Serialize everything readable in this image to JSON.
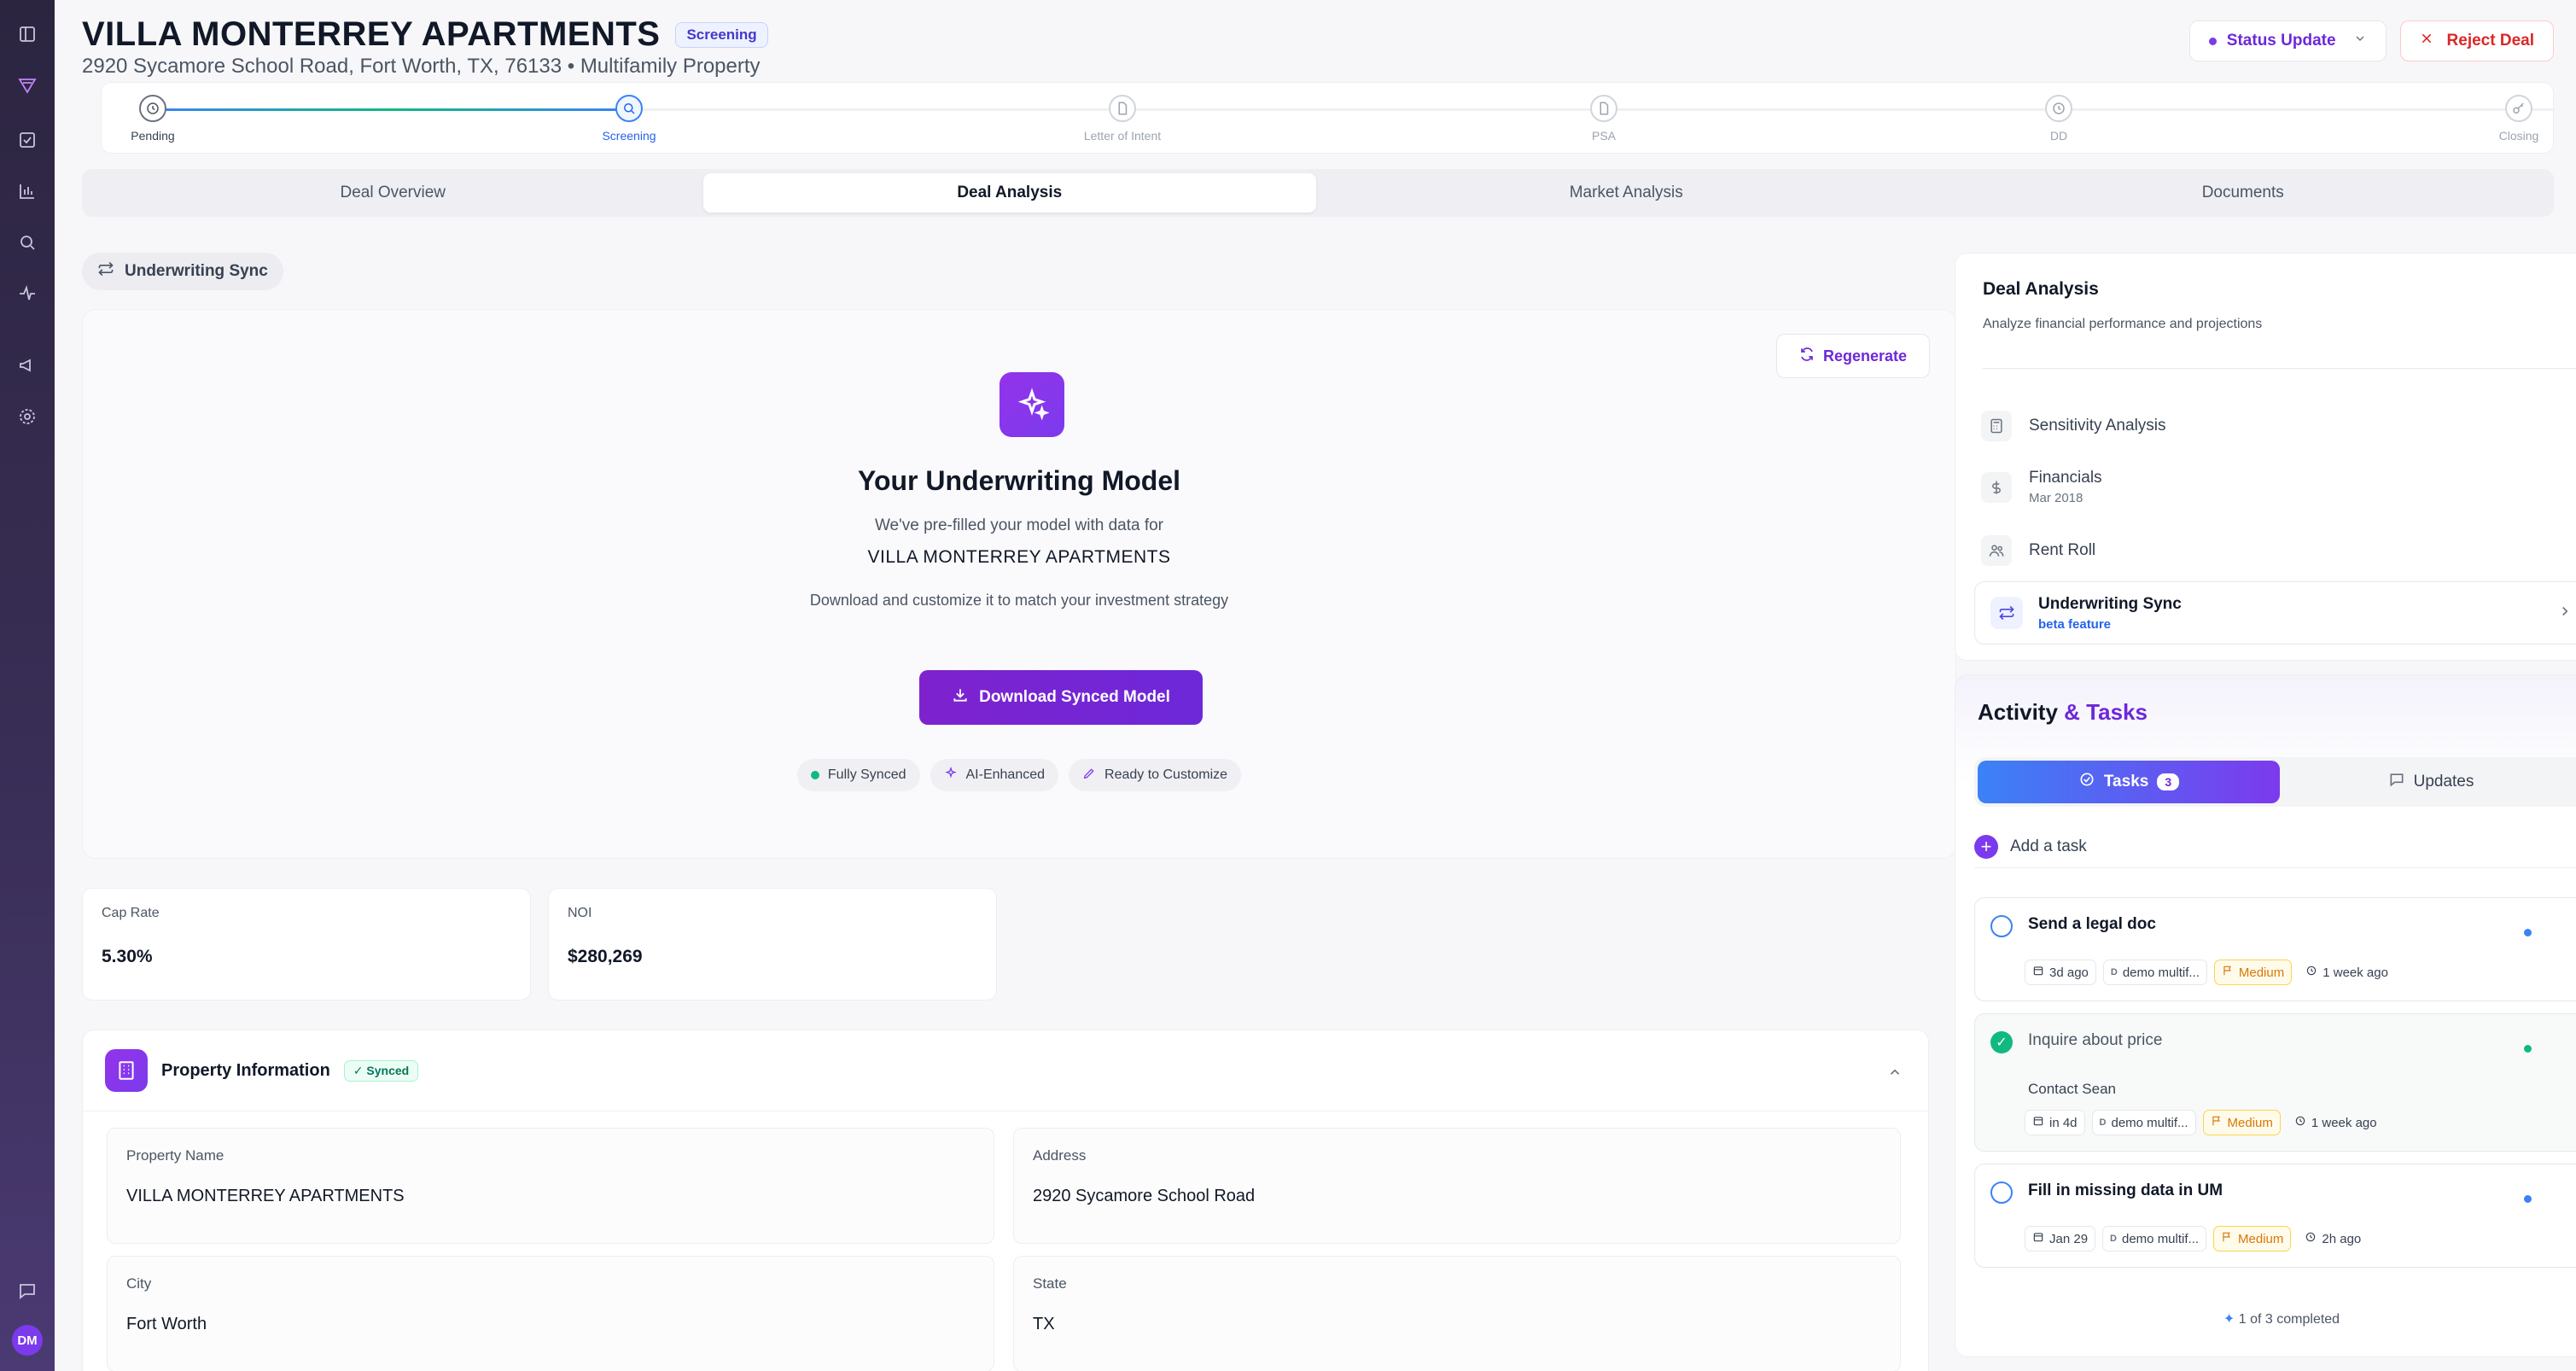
{
  "header": {
    "title": "VILLA MONTERREY APARTMENTS",
    "stage_badge": "Screening",
    "subtitle": "2920 Sycamore School Road, Fort Worth, TX, 76133 • Multifamily Property",
    "status_button": "Status Update",
    "reject_button": "Reject Deal"
  },
  "stepper": {
    "steps": [
      {
        "label": "Pending",
        "state": "done",
        "icon": "clock-icon"
      },
      {
        "label": "Screening",
        "state": "active",
        "icon": "search-icon"
      },
      {
        "label": "Letter of Intent",
        "state": "pending",
        "icon": "file-icon"
      },
      {
        "label": "PSA",
        "state": "pending",
        "icon": "file-icon"
      },
      {
        "label": "DD",
        "state": "pending",
        "icon": "clock-icon"
      },
      {
        "label": "Closing",
        "state": "pending",
        "icon": "key-icon"
      }
    ]
  },
  "tabs": [
    {
      "label": "Deal Overview"
    },
    {
      "label": "Deal Analysis"
    },
    {
      "label": "Market Analysis"
    },
    {
      "label": "Documents"
    }
  ],
  "active_tab": "Deal Analysis",
  "sync_chip": "Underwriting Sync",
  "hero": {
    "regenerate": "Regenerate",
    "title": "Your Underwriting Model",
    "text1": "We've pre-filled your model with data for",
    "property_name": "VILLA MONTERREY APARTMENTS",
    "text2": "Download and customize it to match your investment strategy",
    "download": "Download Synced Model",
    "pills": [
      "Fully Synced",
      "AI-Enhanced",
      "Ready to Customize"
    ]
  },
  "metrics": [
    {
      "label": "Cap Rate",
      "value": "5.30%"
    },
    {
      "label": "NOI",
      "value": "$280,269"
    }
  ],
  "property": {
    "title": "Property Information",
    "badge": "Synced",
    "fields": [
      {
        "label": "Property Name",
        "value": "VILLA MONTERREY APARTMENTS"
      },
      {
        "label": "Address",
        "value": "2920 Sycamore School Road"
      },
      {
        "label": "City",
        "value": "Fort Worth"
      },
      {
        "label": "State",
        "value": "TX"
      }
    ]
  },
  "deal_panel": {
    "title": "Deal Analysis",
    "subtitle": "Analyze financial performance and projections",
    "items": [
      {
        "label": "Sensitivity Analysis",
        "sub": "",
        "icon": "calculator-icon"
      },
      {
        "label": "Financials",
        "sub": "Mar 2018",
        "icon": "dollar-icon"
      },
      {
        "label": "Rent Roll",
        "sub": "",
        "icon": "users-icon"
      }
    ],
    "sync": {
      "label": "Underwriting Sync",
      "sub": "beta feature"
    }
  },
  "activity": {
    "title_a": "Activity",
    "title_b": "& Tasks",
    "tasks_tab": "Tasks",
    "tasks_count": "3",
    "updates_tab": "Updates",
    "add_task": "Add a task",
    "tasks": [
      {
        "title": "Send a legal doc",
        "note": "",
        "done": false,
        "due": "3d ago",
        "owner": "demo multif...",
        "priority": "Medium",
        "time": "1 week ago",
        "dot": "#3b82f6"
      },
      {
        "title": "Inquire about price",
        "note": "Contact Sean",
        "done": true,
        "due": "in 4d",
        "owner": "demo multif...",
        "priority": "Medium",
        "time": "1 week ago",
        "dot": "#10b981"
      },
      {
        "title": "Fill in missing data in UM",
        "note": "",
        "done": false,
        "due": "Jan 29",
        "owner": "demo multif...",
        "priority": "Medium",
        "time": "2h ago",
        "dot": "#3b82f6"
      }
    ],
    "footer": "1 of 3 completed"
  },
  "user": {
    "initials": "DM"
  },
  "colors": {
    "accent": "#7c3aed",
    "blue": "#3b82f6",
    "danger": "#dc2626",
    "success": "#10b981"
  }
}
